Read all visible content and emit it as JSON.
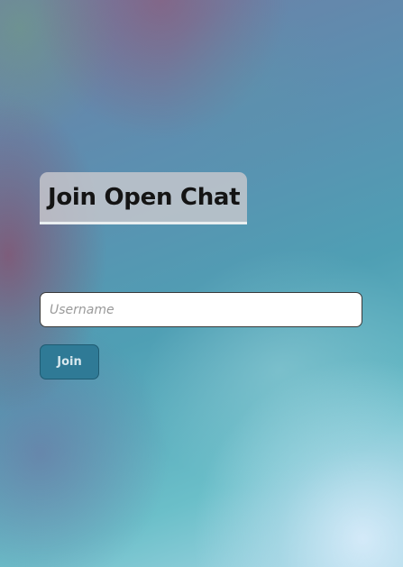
{
  "page": {
    "title": "Join Open Chat"
  },
  "form": {
    "username_placeholder": "Username",
    "username_value": "",
    "join_label": "Join"
  },
  "colors": {
    "button_bg": "#2f7a96",
    "title_bg": "#c8c8cd",
    "title_text": "#141414"
  }
}
